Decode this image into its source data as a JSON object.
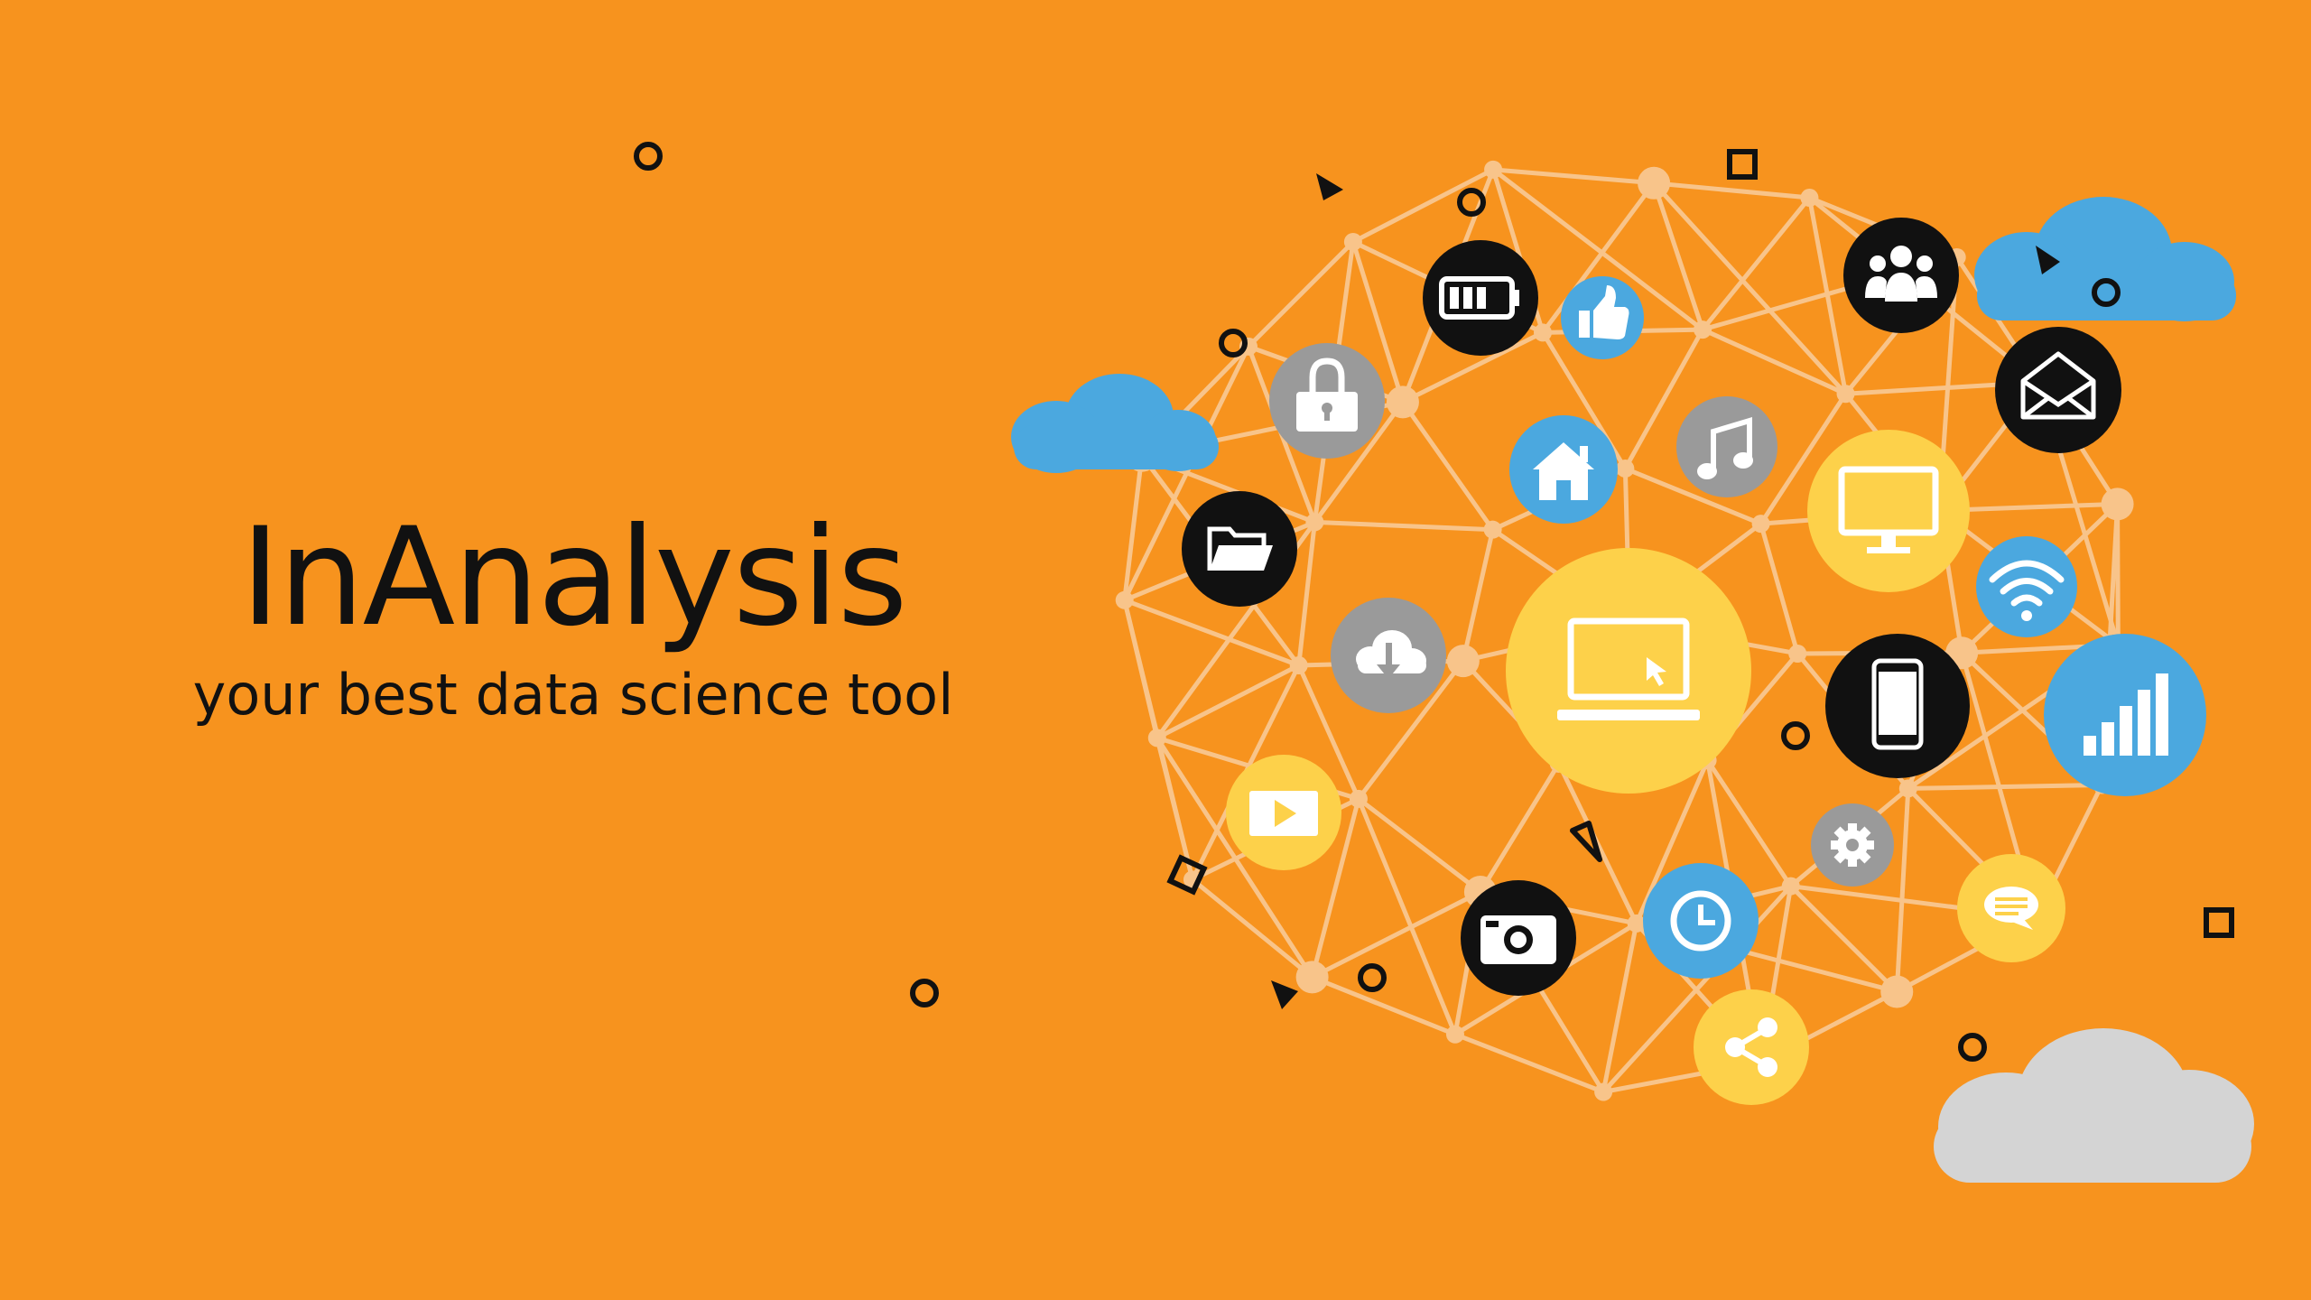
{
  "app": {
    "title": "InAnalysis",
    "tagline": "your best data science tool"
  },
  "colors": {
    "background": "#F7931E",
    "network": "#F8C48A",
    "black": "#111111",
    "blue": "#4BA8DF",
    "yellow": "#FDD14A",
    "gray": "#9A9A9A",
    "cloud_gray": "#D4D4D4"
  },
  "icons": [
    "battery-icon",
    "thumbs-up-icon",
    "users-icon",
    "envelope-icon",
    "lock-icon",
    "home-icon",
    "music-icon",
    "monitor-icon",
    "folder-icon",
    "wifi-icon",
    "cloud-download-icon",
    "laptop-icon",
    "smartphone-icon",
    "signal-bars-icon",
    "play-icon",
    "gear-icon",
    "camera-icon",
    "clock-icon",
    "chat-icon",
    "share-icon"
  ]
}
